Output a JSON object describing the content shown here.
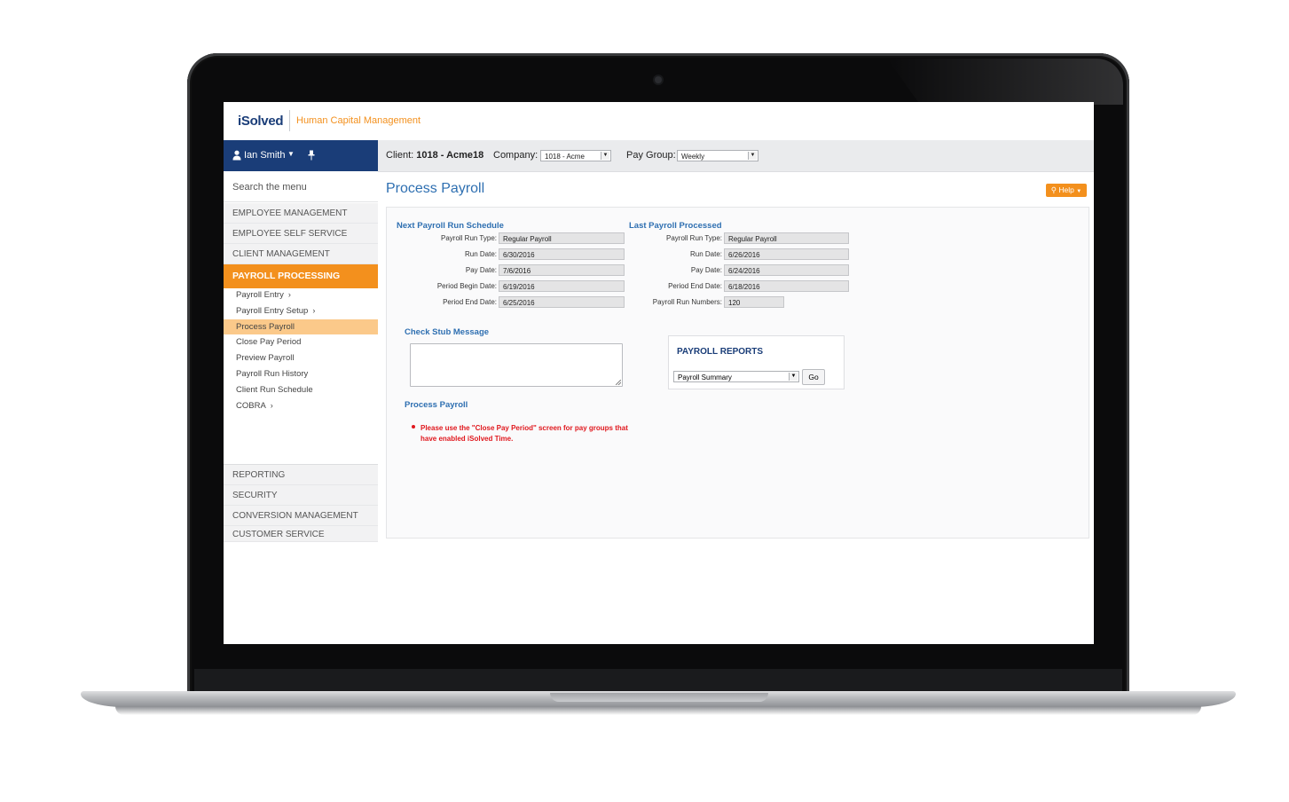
{
  "app": {
    "logo": "iSolved",
    "tagline": "Human Capital Management"
  },
  "user": {
    "name": "Ian Smith"
  },
  "filters": {
    "client_label": "Client:",
    "client_value": "1018 - Acme18",
    "company_label": "Company:",
    "company_value": "1018 - Acme",
    "paygroup_label": "Pay Group:",
    "paygroup_value": "Weekly"
  },
  "sidebar": {
    "search_placeholder": "Search the menu",
    "top_items": [
      "EMPLOYEE MANAGEMENT",
      "EMPLOYEE SELF SERVICE",
      "CLIENT MANAGEMENT"
    ],
    "active_section": "PAYROLL PROCESSING",
    "sub_items": [
      "Payroll Entry",
      "Payroll Entry Setup",
      "Process Payroll",
      "Close Pay Period",
      "Preview Payroll",
      "Payroll Run History",
      "Client Run Schedule",
      "COBRA"
    ],
    "bottom_items": [
      "REPORTING",
      "SECURITY",
      "CONVERSION MANAGEMENT",
      "CUSTOMER SERVICE"
    ]
  },
  "main": {
    "title": "Process Payroll",
    "help_label": "Help",
    "next_schedule": {
      "title": "Next Payroll Run Schedule",
      "fields": [
        {
          "label": "Payroll Run Type:",
          "value": "Regular Payroll"
        },
        {
          "label": "Run Date:",
          "value": "6/30/2016"
        },
        {
          "label": "Pay Date:",
          "value": "7/6/2016"
        },
        {
          "label": "Period Begin Date:",
          "value": "6/19/2016"
        },
        {
          "label": "Period End Date:",
          "value": "6/25/2016"
        }
      ]
    },
    "last_processed": {
      "title": "Last Payroll Processed",
      "fields": [
        {
          "label": "Payroll Run Type:",
          "value": "Regular Payroll"
        },
        {
          "label": "Run Date:",
          "value": "6/26/2016"
        },
        {
          "label": "Pay Date:",
          "value": "6/24/2016"
        },
        {
          "label": "Period End Date:",
          "value": "6/18/2016"
        },
        {
          "label": "Payroll Run Numbers:",
          "value": "120"
        }
      ]
    },
    "check_stub_title": "Check Stub Message",
    "process_payroll_title": "Process Payroll",
    "notice": "Please use the \"Close Pay Period\" screen for pay groups that have enabled iSolved Time.",
    "reports": {
      "title": "PAYROLL REPORTS",
      "selected": "Payroll Summary",
      "go_label": "Go"
    }
  },
  "colors": {
    "navy": "#1a3d78",
    "orange": "#f3901d",
    "link_blue": "#2e6fb1",
    "alert_red": "#e0181e"
  }
}
